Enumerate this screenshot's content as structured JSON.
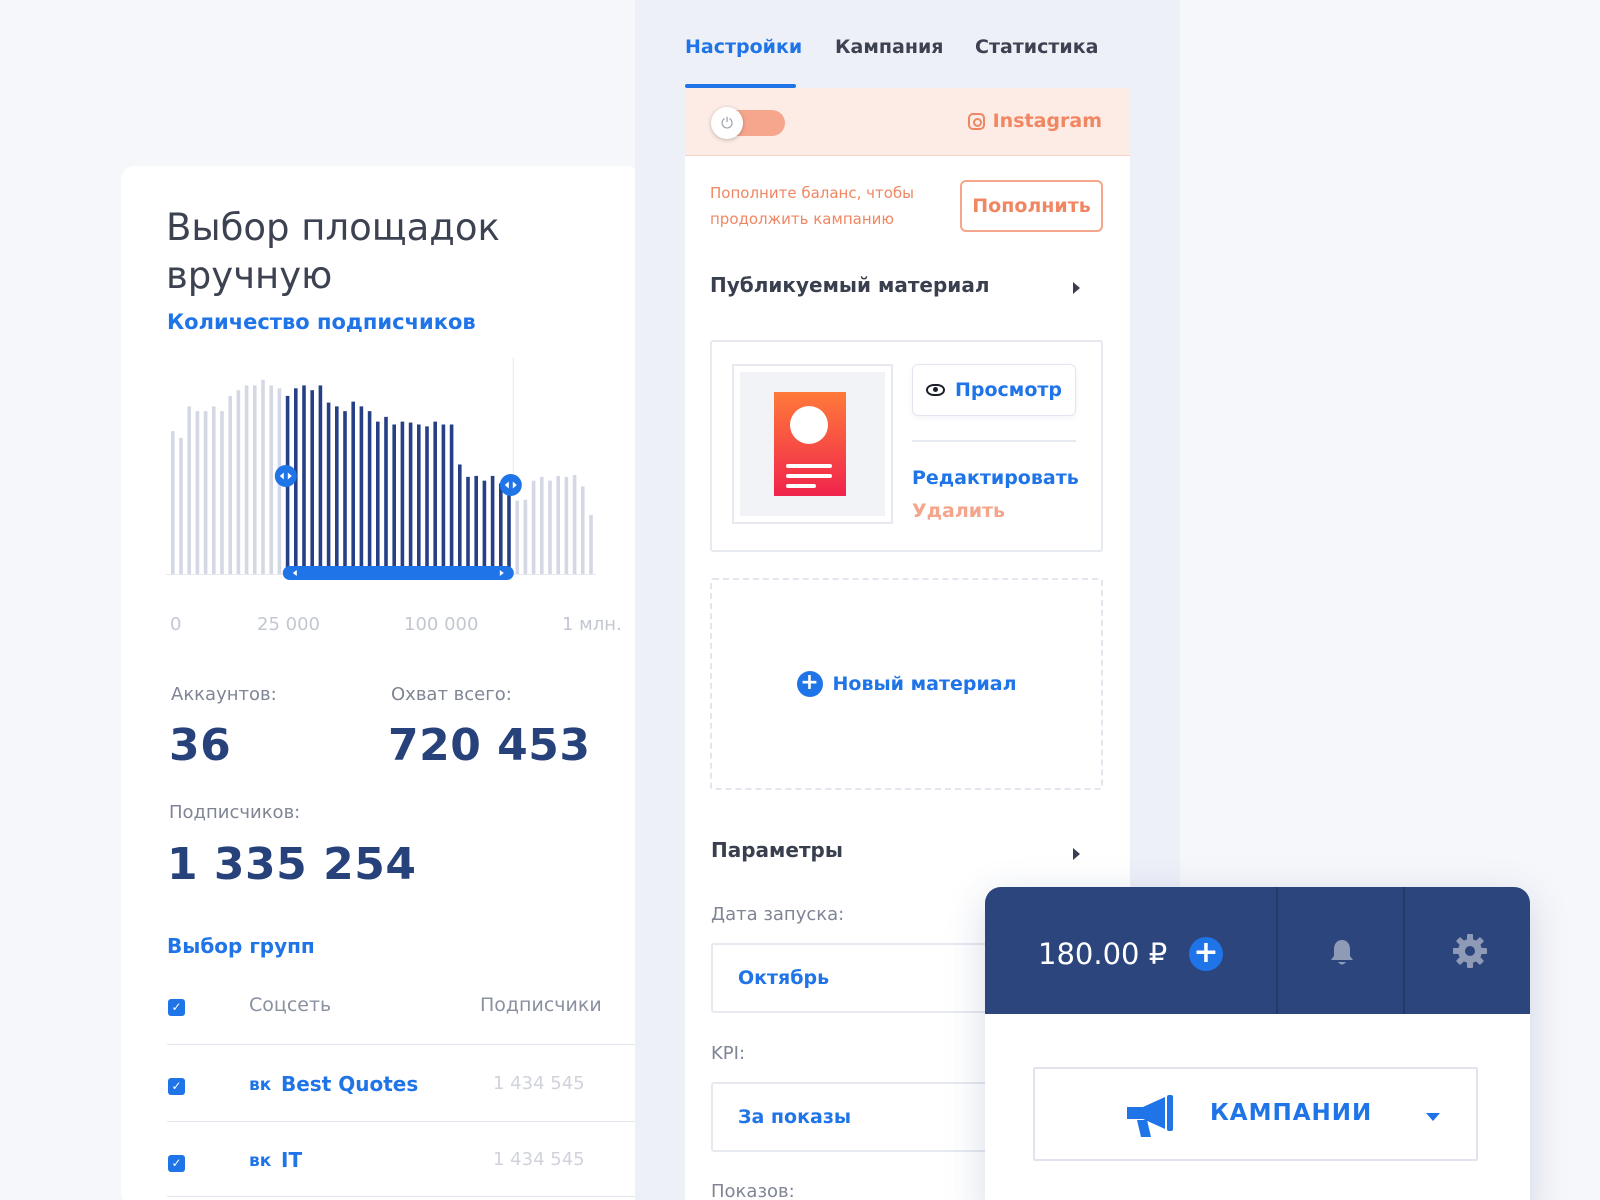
{
  "left_card": {
    "title": "Выбор площадок вручную",
    "subtitle": "Количество подписчиков",
    "chart_data": {
      "type": "bar",
      "title": "Количество подписчиков",
      "x_tick_labels": [
        "0",
        "25 000",
        "100 000",
        "1 млн."
      ],
      "values": [
        150,
        143,
        176,
        171,
        171,
        176,
        171,
        187,
        193,
        198,
        198,
        204,
        198,
        195,
        187,
        195,
        198,
        193,
        198,
        180,
        176,
        171,
        181,
        176,
        171,
        160,
        165,
        157,
        160,
        159,
        157,
        155,
        160,
        157,
        157,
        115,
        102,
        103,
        98,
        103,
        95,
        85,
        77,
        78,
        98,
        102,
        98,
        103,
        102,
        104,
        92,
        62
      ],
      "selected_range": [
        14,
        41
      ],
      "colors": {
        "selected": "#273f85",
        "unselected": "#d4d8e4",
        "handle": "#1f74e8"
      }
    },
    "stats": {
      "accounts_label": "Аккаунтов:",
      "accounts_value": "36",
      "reach_label": "Охват всего:",
      "reach_value": "720 453",
      "subs_label": "Подписчиков:",
      "subs_value": "1 335 254"
    },
    "groups": {
      "title": "Выбор групп",
      "col_network": "Соцсеть",
      "col_subscribers": "Подписчики",
      "network_icon": "vk-icon",
      "vk_glyph": "вк",
      "rows": [
        {
          "name": "Best Quotes",
          "subscribers": "1 434 545"
        },
        {
          "name": "IT",
          "subscribers": "1 434 545"
        }
      ]
    }
  },
  "middle": {
    "tabs": [
      {
        "label": "Настройки",
        "active": true
      },
      {
        "label": "Кампания",
        "active": false
      },
      {
        "label": "Статистика",
        "active": false
      }
    ],
    "alert": {
      "network": "Instagram",
      "message": "Пополните баланс, чтобы продолжить кампанию",
      "topup_label": "Пополнить"
    },
    "material": {
      "section_title": "Публикуемый материал",
      "view_label": "Просмотр",
      "edit_label": "Редактировать",
      "delete_label": "Удалить",
      "new_label": "Новый материал"
    },
    "params": {
      "section_title": "Параметры",
      "launch_label": "Дата запуска:",
      "launch_value": "Октябрь",
      "kpi_label": "KPI:",
      "kpi_value": "За показы",
      "impressions_label": "Показов:"
    }
  },
  "widget": {
    "balance": "180.00 ₽",
    "campaigns_label": "КАМПАНИИ"
  },
  "colors": {
    "accent": "#1f74e8",
    "navy": "#2c467d",
    "warning": "#f18662"
  }
}
